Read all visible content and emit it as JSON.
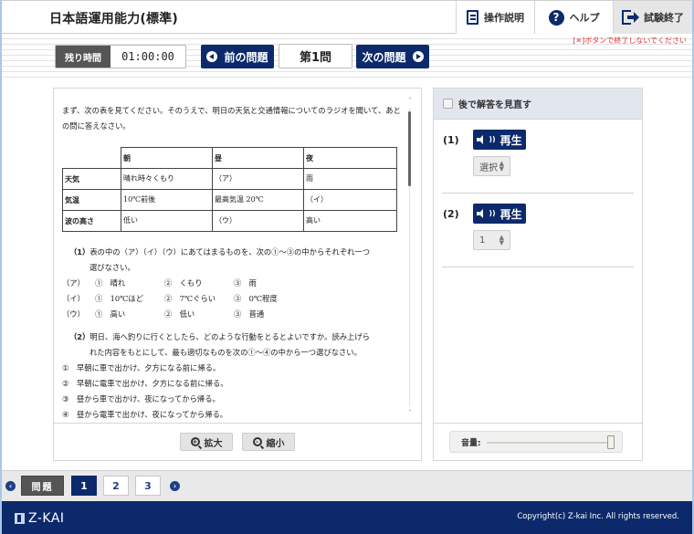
{
  "header": {
    "title": "日本語運用能力(標準)",
    "buttons": {
      "manual": "操作説明",
      "help": "ヘルプ",
      "exit": "試験終了"
    },
    "help_glyph": "?"
  },
  "toolbar": {
    "warning": "[✕]ボタンで終了しないでください",
    "timer_label": "残り時間",
    "timer_value": "01:00:00",
    "prev_label": "前の問題",
    "question_number": "第1問",
    "next_label": "次の問題"
  },
  "question": {
    "intro": "まず、次の表を見てください。そのうえで、明日の天気と交通情報についてのラジオを聞いて、あとの問に答えなさい。",
    "table": {
      "headers": [
        "",
        "朝",
        "昼",
        "夜"
      ],
      "rows": [
        [
          "天気",
          "晴れ時々くもり",
          "（ア）",
          "雨"
        ],
        [
          "気温",
          "10℃前後",
          "最高気温 20℃",
          "（イ）"
        ],
        [
          "波の高さ",
          "低い",
          "（ウ）",
          "高い"
        ]
      ]
    },
    "q1": {
      "number": "（1）",
      "text": "表の中の（ア）（イ）（ウ）にあてはまるものを、次の①～③の中からそれぞれ一つ",
      "text_cont": "選びなさい。",
      "options": [
        {
          "label": "（ア）",
          "choices": [
            "①　晴れ",
            "②　くもり",
            "③　雨"
          ]
        },
        {
          "label": "（イ）",
          "choices": [
            "①　10℃ほど",
            "②　7℃ぐらい",
            "③　0℃程度"
          ]
        },
        {
          "label": "（ウ）",
          "choices": [
            "①　高い",
            "②　低い",
            "③　普通"
          ]
        }
      ]
    },
    "q2": {
      "number": "（2）",
      "text": "明日、海へ釣りに行くとしたら、どのような行動をとるとよいですか。読み上げら",
      "text_cont": "れた内容をもとにして、最も適切なものを次の①～④の中から一つ選びなさい。",
      "choices": [
        {
          "n": "①",
          "t": "早朝に車で出かけ、夕方になる前に帰る。"
        },
        {
          "n": "②",
          "t": "早朝に電車で出かけ、夕方になる前に帰る。"
        },
        {
          "n": "③",
          "t": "昼から車で出かけ、夜になってから帰る。"
        },
        {
          "n": "④",
          "t": "昼から電車で出かけ、夜になってから帰る。"
        }
      ]
    },
    "zoom_in": "拡大",
    "zoom_out": "縮小"
  },
  "answers": {
    "review_label": "後で解答を見直す",
    "review_checked": false,
    "items": [
      {
        "label": "(1)",
        "play": "再生",
        "select_value": "選択"
      },
      {
        "label": "(2)",
        "play": "再生",
        "select_value": "1"
      }
    ],
    "volume_label": "音量:",
    "volume_level": 1.0
  },
  "bottom_nav": {
    "section_label": "問題",
    "pages": [
      "1",
      "2",
      "3"
    ],
    "current_page": "1",
    "prev_glyph": "‹",
    "next_glyph": "›"
  },
  "footer": {
    "logo": "Z-KAI",
    "copyright": "Copyright(c) Z-kai Inc. All rights reserved."
  },
  "colors": {
    "brand_navy": "#0c2a6b",
    "warning_red": "#e53030",
    "timer_label_bg": "#555555"
  }
}
